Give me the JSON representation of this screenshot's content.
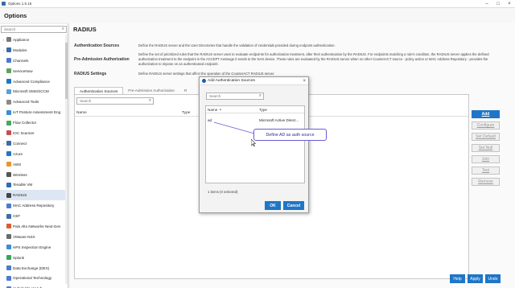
{
  "window": {
    "title": "Options 1.5.15"
  },
  "header": {
    "title": "Options"
  },
  "sidebar": {
    "search_placeholder": "Search",
    "items": [
      {
        "label": "Appliance",
        "arrow": "›",
        "color": "#7a7a7a"
      },
      {
        "label": "Modules",
        "arrow": "›",
        "color": "#3a6ea5"
      },
      {
        "label": "Channels",
        "arrow": "",
        "color": "#4b7bd0"
      },
      {
        "label": "ServiceNow",
        "arrow": "",
        "color": "#5ea35e"
      },
      {
        "label": "Advanced Compliance",
        "arrow": "",
        "color": "#1f76c6"
      },
      {
        "label": "Microsoft SMS/SCCM",
        "arrow": "",
        "color": "#5aa0d6"
      },
      {
        "label": "Advanced Tools",
        "arrow": "",
        "color": "#8a8a8a"
      },
      {
        "label": "IoT Posture Assessment Eng",
        "arrow": "",
        "color": "#3a8dd6"
      },
      {
        "label": "Flow Collector",
        "arrow": "",
        "color": "#49a85c"
      },
      {
        "label": "IOC Scanner",
        "arrow": "",
        "color": "#c74d4d"
      },
      {
        "label": "Connect",
        "arrow": "›",
        "color": "#3a6ea5"
      },
      {
        "label": "Azure",
        "arrow": "",
        "color": "#1f76c6"
      },
      {
        "label": "AWS",
        "arrow": "",
        "color": "#e8962e"
      },
      {
        "label": "Wireless",
        "arrow": "",
        "color": "#555555"
      },
      {
        "label": "Tenable VM",
        "arrow": "",
        "color": "#2b6fb0"
      },
      {
        "label": "RADIUS",
        "arrow": "",
        "color": "#444444",
        "selected": true
      },
      {
        "label": "MAC Address Repository",
        "arrow": "",
        "color": "#4b7bd0"
      },
      {
        "label": "CEF",
        "arrow": "",
        "color": "#3a6ea5"
      },
      {
        "label": "Palo Alto Networks Next-Gen",
        "arrow": "",
        "color": "#e05a2b"
      },
      {
        "label": "VMware NSX",
        "arrow": "",
        "color": "#6a6a6a"
      },
      {
        "label": "HPS Inspection Engine",
        "arrow": "",
        "color": "#3a8dd6"
      },
      {
        "label": "Splunk",
        "arrow": "",
        "color": "#3aa35a"
      },
      {
        "label": "Data Exchange (DEX)",
        "arrow": "",
        "color": "#4b7bd0"
      },
      {
        "label": "Operational Technology",
        "arrow": "",
        "color": "#4b7bd0"
      },
      {
        "label": "Hybrid Cloud Hub",
        "arrow": "",
        "color": "#4b7bd0"
      }
    ]
  },
  "main": {
    "title": "RADIUS",
    "descriptions": [
      {
        "label": "Authentication Sources",
        "text": "Define the RADIUS server and the User Directories that handle the validation of credentials provided during endpoint authentication."
      },
      {
        "label": "Pre-Admission Authorization",
        "text": "Define the set of prioritized rules that the RADIUS server uses to evaluate endpoints for authorization treatment, after their authentication by the RADIUS. For endpoints matching a rule's condition, the RADIUS server applies the defined authorization treatment to the endpoint in the ACCEPT message it sends to the NAS device. These rules are evaluated by the RADIUS server when no other CounterACT source - policy action or MAC Address Repository - provides the authorization to impose on an authenticated endpoint."
      },
      {
        "label": "RADIUS Settings",
        "text": "Define RADIUS server settings that affect the operation of the CounterACT RADIUS server."
      }
    ],
    "tabs": [
      "Authentication Sources",
      "Pre-Admission Authorization",
      "R"
    ],
    "table_search_placeholder": "Search",
    "table_columns": [
      "Name",
      "Type"
    ],
    "side_buttons": [
      {
        "label": "Add",
        "primary": true
      },
      {
        "label": "Configure"
      },
      {
        "label": "Set Default"
      },
      {
        "label": "Set Null"
      },
      {
        "label": "Join"
      },
      {
        "label": "Test"
      },
      {
        "label": "Remove"
      }
    ],
    "bottom_buttons": [
      "Help",
      "Apply",
      "Undo"
    ]
  },
  "dialog": {
    "title": "Add Authentication Sources",
    "close_glyph": "×",
    "search_placeholder": "Search",
    "columns": {
      "name": "Name",
      "sort_indicator": "▲",
      "type": "Type"
    },
    "rows": [
      {
        "name": "ad",
        "type": "Microsoft Active Direct..."
      }
    ],
    "status": "1 items (0 selected)",
    "ok_label": "OK",
    "cancel_label": "Cancel"
  },
  "annotation": {
    "text": "Define AD as auth source"
  }
}
